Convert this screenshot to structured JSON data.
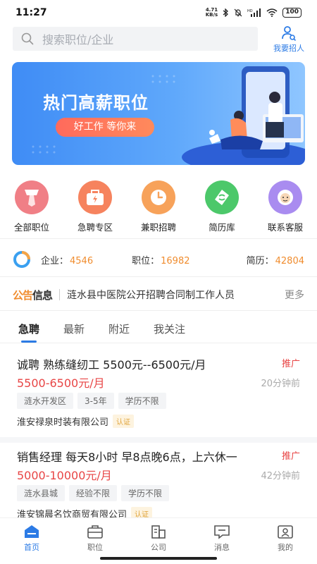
{
  "status_bar": {
    "time": "11:27",
    "net_speed_top": "4.71",
    "net_speed_bottom": "KB/s",
    "battery": "100"
  },
  "search": {
    "placeholder": "搜索职位/企业"
  },
  "recruit": {
    "label": "我要招人"
  },
  "banner": {
    "title": "热门高薪职位",
    "subtitle": "好工作 等你来"
  },
  "quick": [
    {
      "label": "全部职位",
      "color": "#f07f86",
      "icon": "tie-icon"
    },
    {
      "label": "急聘专区",
      "color": "#f6835e",
      "icon": "bag-icon"
    },
    {
      "label": "兼职招聘",
      "color": "#f7a25a",
      "icon": "clock-icon"
    },
    {
      "label": "简历库",
      "color": "#4cc86a",
      "icon": "resume-icon"
    },
    {
      "label": "联系客服",
      "color": "#a98cf0",
      "icon": "service-icon"
    }
  ],
  "stats": {
    "company_label": "企业：",
    "company_value": "4546",
    "job_label": "职位：",
    "job_value": "16982",
    "resume_label": "简历：",
    "resume_value": "42804"
  },
  "notice": {
    "badge_a": "公告",
    "badge_b": "信息",
    "text": "涟水县中医院公开招聘合同制工作人员",
    "more": "更多"
  },
  "tabs": [
    "急聘",
    "最新",
    "附近",
    "我关注"
  ],
  "jobs": [
    {
      "title": "诚聘   熟练缝纫工          5500元--6500元/月",
      "promo": "推广",
      "salary": "5500-6500元/月",
      "time": "20分钟前",
      "tags": [
        "涟水开发区",
        "3-5年",
        "学历不限"
      ],
      "company": "淮安禄泉时装有限公司",
      "cert": "认证"
    },
    {
      "title": "销售经理   每天8小时   早8点晚6点，上六休一",
      "promo": "推广",
      "salary": "5000-10000元/月",
      "time": "42分钟前",
      "tags": [
        "涟水县城",
        "经验不限",
        "学历不限"
      ],
      "company": "淮安锦晨名饮商贸有限公司",
      "cert": "认证"
    }
  ],
  "nav": [
    {
      "label": "首页",
      "icon": "home-icon"
    },
    {
      "label": "职位",
      "icon": "briefcase-icon"
    },
    {
      "label": "公司",
      "icon": "building-icon"
    },
    {
      "label": "消息",
      "icon": "message-icon"
    },
    {
      "label": "我的",
      "icon": "profile-icon"
    }
  ],
  "colors": {
    "accent": "#2c7be5",
    "salary": "#e84545",
    "stat_number": "#f08c2e"
  }
}
